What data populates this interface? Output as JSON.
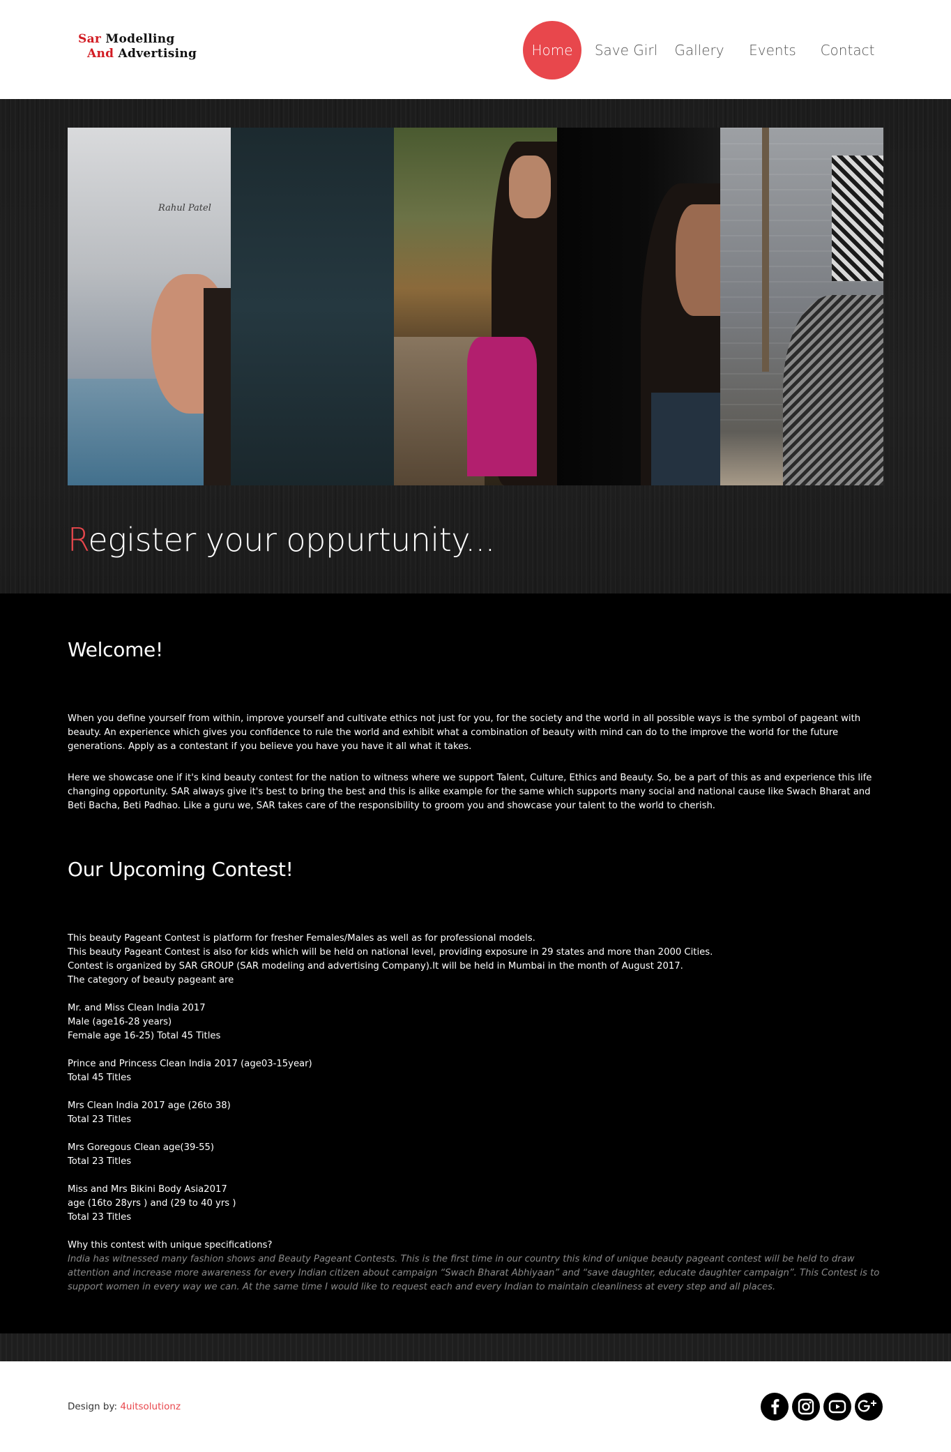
{
  "logo": {
    "line1_red": "Sar",
    "line1_rest": " Modelling",
    "line2_red": "And",
    "line2_rest": " Advertising"
  },
  "nav": {
    "items": [
      {
        "label": "Home",
        "active": true
      },
      {
        "label": "Save Girl"
      },
      {
        "label": "Gallery"
      },
      {
        "label": "Events"
      },
      {
        "label": "Contact"
      }
    ]
  },
  "hero": {
    "title_accent": "R",
    "title_rest": "egister your oppurtunity...",
    "watermark": "Rahul Patel"
  },
  "welcome": {
    "heading": "Welcome!",
    "para1": "When you define yourself from within, improve yourself and cultivate ethics not just for you, for the society and the world in all possible ways is the symbol of pageant with beauty. An experience which gives you confidence to rule the world and exhibit what a combination of beauty with mind can do to the improve the world for the future generations. Apply as a contestant if you believe you have you have it all what it takes.",
    "para2": "Here we showcase one if it's kind beauty contest for the nation to witness where we support Talent, Culture, Ethics and Beauty. So, be a part of this as and experience this life changing opportunity. SAR always give it's best to bring the best and this is alike example for the same which supports many social and national cause like Swach Bharat and Beti Bacha, Beti Padhao. Like a guru we, SAR takes care of the responsibility to groom you and showcase your talent to the world to cherish."
  },
  "contest": {
    "heading": "Our Upcoming Contest!",
    "intro": [
      "This beauty Pageant Contest is platform for fresher Females/Males as well as for professional models.",
      "This beauty Pageant Contest is also for kids which will be held on national level, providing exposure in 29 states and more than 2000 Cities.",
      "Contest is organized by SAR GROUP (SAR modeling and advertising Company).It will be held in Mumbai in the month of August 2017.",
      "The category of beauty pageant are"
    ],
    "categories": [
      [
        "Mr. and Miss Clean India 2017",
        "Male (age16-28 years)",
        "Female age 16-25) Total 45 Titles"
      ],
      [
        "Prince and Princess Clean India 2017 (age03-15year)",
        "Total 45 Titles"
      ],
      [
        "Mrs Clean India 2017 age (26to 38)",
        "Total 23 Titles"
      ],
      [
        "Mrs Goregous Clean age(39-55)",
        "Total 23 Titles"
      ],
      [
        "Miss and Mrs Bikini Body Asia2017",
        "age (16to 28yrs ) and (29 to 40 yrs )",
        "Total 23 Titles"
      ]
    ],
    "why_heading": "Why this contest with unique specifications?",
    "why_text": "India has witnessed many fashion shows and Beauty Pageant Contests. This is the first time in our country this kind of unique beauty pageant contest will be held to draw attention and increase more awareness for every Indian citizen about campaign “Swach Bharat Abhiyaan” and “save daughter, educate daughter campaign”. This Contest is to support women in every way we can. At the same time I would like to request each and every Indian to maintain cleanliness at every step and all places."
  },
  "footer": {
    "credit_prefix": "Design by: ",
    "credit_link": "4uitsolutionz",
    "social": [
      "facebook-icon",
      "instagram-icon",
      "youtube-icon",
      "google-plus-icon"
    ]
  },
  "colors": {
    "accent": "#e8474c",
    "logo_red": "#d21c23"
  }
}
